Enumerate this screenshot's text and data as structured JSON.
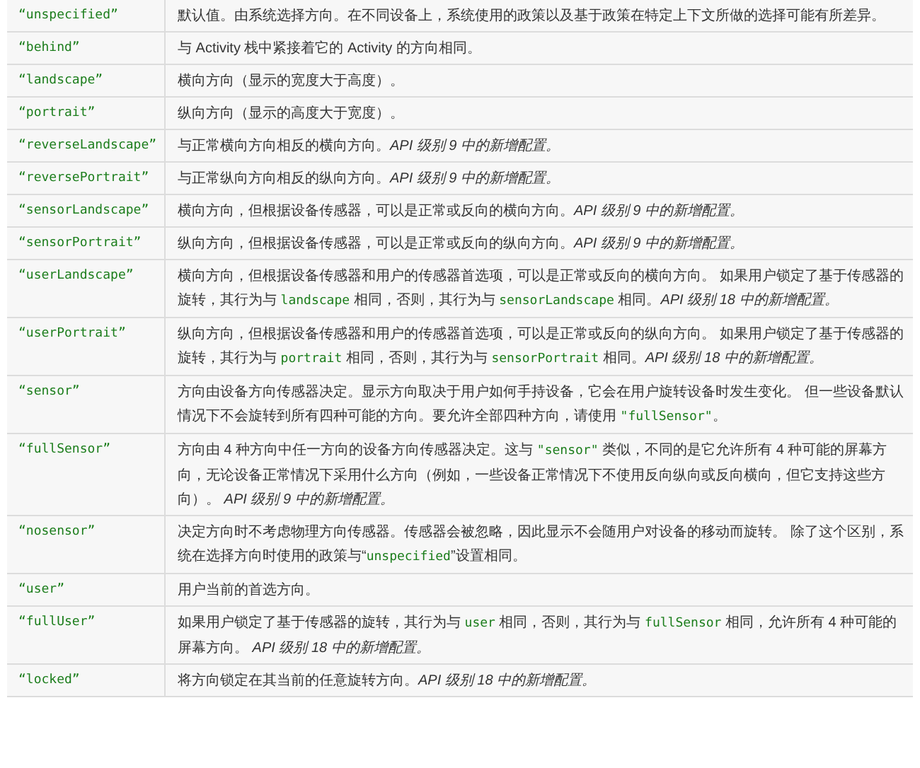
{
  "table": {
    "rows": [
      {
        "value": "“unspecified”",
        "description": [
          {
            "kind": "text",
            "text": "默认值。由系统选择方向。在不同设备上，系统使用的政策以及基于政策在特定上下文所做的选择可能有所差异。"
          }
        ]
      },
      {
        "value": "“behind”",
        "description": [
          {
            "kind": "text",
            "text": "与 Activity 栈中紧接着它的 Activity 的方向相同。"
          }
        ]
      },
      {
        "value": "“landscape”",
        "description": [
          {
            "kind": "text",
            "text": "横向方向（显示的宽度大于高度）。"
          }
        ]
      },
      {
        "value": "“portrait”",
        "description": [
          {
            "kind": "text",
            "text": "纵向方向（显示的高度大于宽度）。"
          }
        ]
      },
      {
        "value": "“reverseLandscape”",
        "description": [
          {
            "kind": "text",
            "text": "与正常横向方向相反的横向方向。"
          },
          {
            "kind": "note",
            "text": "API 级别 9 中的新增配置。"
          }
        ]
      },
      {
        "value": "“reversePortrait”",
        "description": [
          {
            "kind": "text",
            "text": "与正常纵向方向相反的纵向方向。"
          },
          {
            "kind": "note",
            "text": "API 级别 9 中的新增配置。"
          }
        ]
      },
      {
        "value": "“sensorLandscape”",
        "description": [
          {
            "kind": "text",
            "text": "横向方向，但根据设备传感器，可以是正常或反向的横向方向。"
          },
          {
            "kind": "note",
            "text": "API 级别 9 中的新增配置。"
          }
        ]
      },
      {
        "value": "“sensorPortrait”",
        "description": [
          {
            "kind": "text",
            "text": "纵向方向，但根据设备传感器，可以是正常或反向的纵向方向。"
          },
          {
            "kind": "note",
            "text": "API 级别 9 中的新增配置。"
          }
        ]
      },
      {
        "value": "“userLandscape”",
        "description": [
          {
            "kind": "text",
            "text": "横向方向，但根据设备传感器和用户的传感器首选项，可以是正常或反向的横向方向。 如果用户锁定了基于传感器的旋转，其行为与 "
          },
          {
            "kind": "code",
            "text": "landscape"
          },
          {
            "kind": "text",
            "text": " 相同，否则，其行为与 "
          },
          {
            "kind": "code",
            "text": "sensorLandscape"
          },
          {
            "kind": "text",
            "text": " 相同。"
          },
          {
            "kind": "note",
            "text": "API 级别 18 中的新增配置。"
          }
        ]
      },
      {
        "value": "“userPortrait”",
        "description": [
          {
            "kind": "text",
            "text": "纵向方向，但根据设备传感器和用户的传感器首选项，可以是正常或反向的纵向方向。 如果用户锁定了基于传感器的旋转，其行为与 "
          },
          {
            "kind": "code",
            "text": "portrait"
          },
          {
            "kind": "text",
            "text": " 相同，否则，其行为与 "
          },
          {
            "kind": "code",
            "text": "sensorPortrait"
          },
          {
            "kind": "text",
            "text": " 相同。"
          },
          {
            "kind": "note",
            "text": "API 级别 18 中的新增配置。"
          }
        ]
      },
      {
        "value": "“sensor”",
        "description": [
          {
            "kind": "text",
            "text": "方向由设备方向传感器决定。显示方向取决于用户如何手持设备，它会在用户旋转设备时发生变化。 但一些设备默认情况下不会旋转到所有四种可能的方向。要允许全部四种方向，请使用 "
          },
          {
            "kind": "code",
            "text": "\"fullSensor\""
          },
          {
            "kind": "text",
            "text": "。"
          }
        ]
      },
      {
        "value": "“fullSensor”",
        "description": [
          {
            "kind": "text",
            "text": "方向由 4 种方向中任一方向的设备方向传感器决定。这与 "
          },
          {
            "kind": "code",
            "text": "\"sensor\""
          },
          {
            "kind": "text",
            "text": " 类似，不同的是它允许所有 4 种可能的屏幕方向，无论设备正常情况下采用什么方向（例如，一些设备正常情况下不使用反向纵向或反向横向，但它支持这些方向）。 "
          },
          {
            "kind": "note",
            "text": "API 级别 9 中的新增配置。"
          }
        ]
      },
      {
        "value": "“nosensor”",
        "description": [
          {
            "kind": "text",
            "text": "决定方向时不考虑物理方向传感器。传感器会被忽略，因此显示不会随用户对设备的移动而旋转。 除了这个区别，系统在选择方向时使用的政策与“"
          },
          {
            "kind": "code",
            "text": "unspecified"
          },
          {
            "kind": "text",
            "text": "”设置相同。"
          }
        ]
      },
      {
        "value": "“user”",
        "description": [
          {
            "kind": "text",
            "text": "用户当前的首选方向。"
          }
        ]
      },
      {
        "value": "“fullUser”",
        "description": [
          {
            "kind": "text",
            "text": "如果用户锁定了基于传感器的旋转，其行为与 "
          },
          {
            "kind": "code",
            "text": "user"
          },
          {
            "kind": "text",
            "text": " 相同，否则，其行为与 "
          },
          {
            "kind": "code",
            "text": "fullSensor"
          },
          {
            "kind": "text",
            "text": " 相同，允许所有 4 种可能的屏幕方向。 "
          },
          {
            "kind": "note",
            "text": "API 级别 18 中的新增配置。"
          }
        ]
      },
      {
        "value": "“locked”",
        "description": [
          {
            "kind": "text",
            "text": "将方向锁定在其当前的任意旋转方向。"
          },
          {
            "kind": "note",
            "text": "API 级别 18 中的新增配置。"
          }
        ]
      }
    ]
  }
}
